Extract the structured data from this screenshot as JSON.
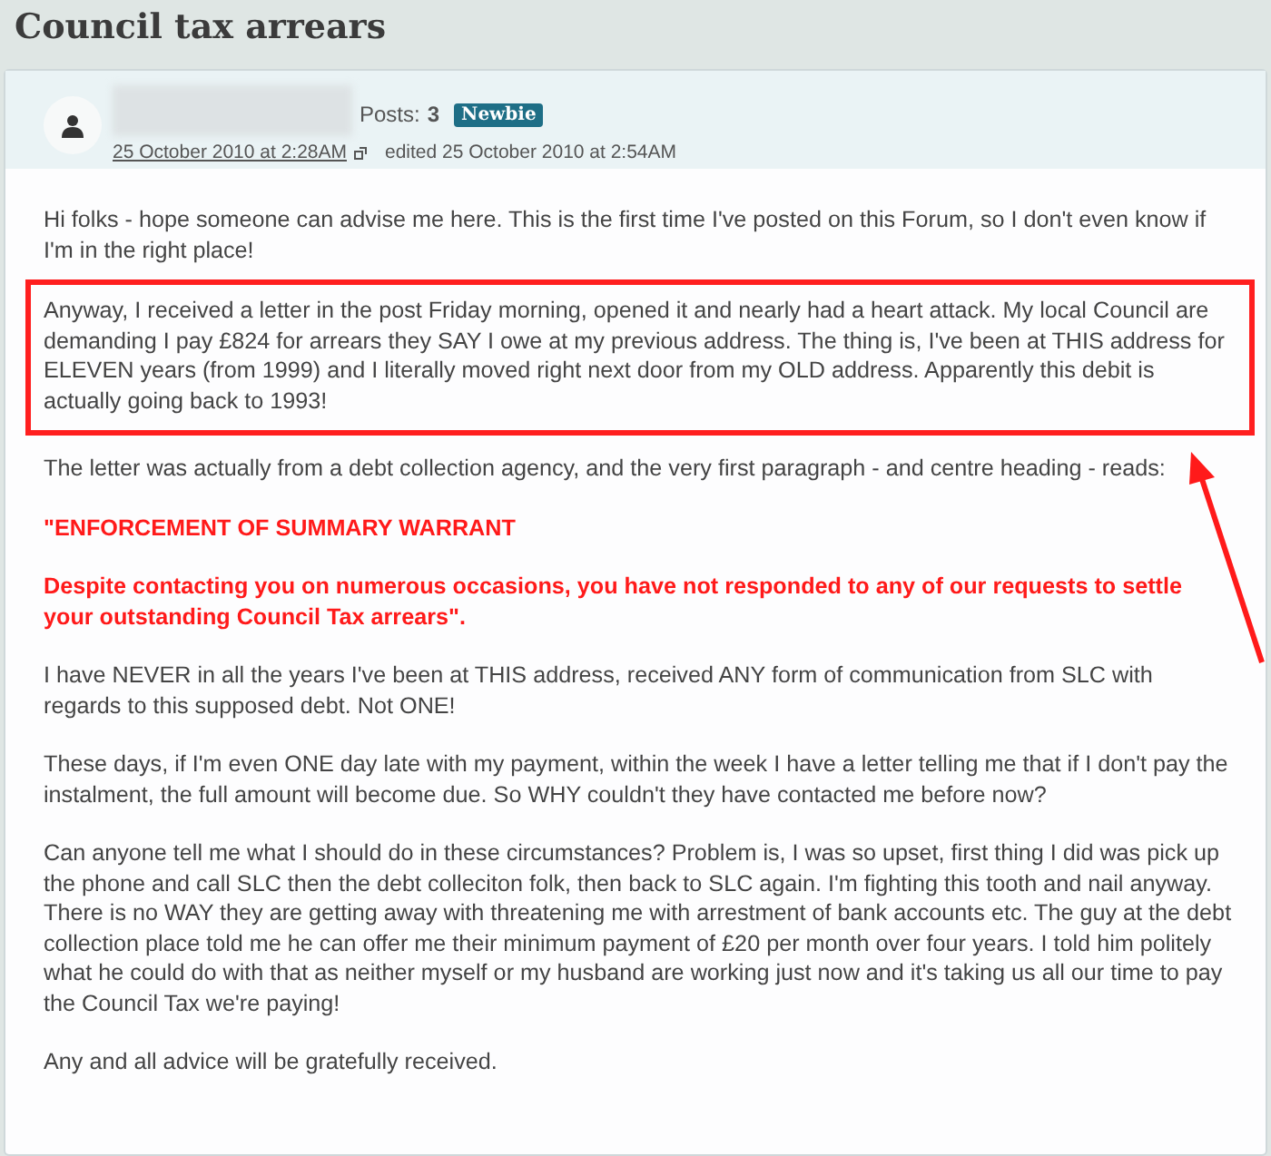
{
  "title": "Council tax arrears",
  "post": {
    "posts_label": "Posts:",
    "posts_count": "3",
    "badge": "Newbie",
    "date": "25 October 2010 at 2:28AM",
    "edited": "edited 25 October 2010 at 2:54AM",
    "paragraphs": [
      {
        "kind": "plain",
        "text": "Hi folks - hope someone can advise me here. This is the first time I've posted on this Forum, so I don't even know if I'm in the right place!"
      },
      {
        "kind": "highlighted",
        "text": "Anyway, I received a letter in the post Friday morning, opened it and nearly had a heart attack. My local Council are demanding I pay £824 for arrears they SAY I owe at my previous address. The thing is, I've been at THIS address for ELEVEN years (from 1999) and I literally moved right next door from my OLD address. Apparently this debit is actually going back to 1993!"
      },
      {
        "kind": "plain",
        "text": "The letter was actually from a debt collection agency, and the very first paragraph - and centre heading - reads:"
      },
      {
        "kind": "quote",
        "text": "\"ENFORCEMENT OF SUMMARY WARRANT"
      },
      {
        "kind": "quote",
        "text": "Despite contacting you on numerous occasions, you have not responded to any of our requests to settle your outstanding Council Tax arrears\"."
      },
      {
        "kind": "plain",
        "text": "I have NEVER in all the years I've been at THIS address, received ANY form of communication from SLC with regards to this supposed debt. Not ONE!"
      },
      {
        "kind": "plain",
        "text": "These days, if I'm even ONE day late with my payment, within the week I have a letter telling me that if I don't pay the instalment, the full amount will become due. So WHY couldn't they have contacted me before now?"
      },
      {
        "kind": "plain",
        "text": "Can anyone tell me what I should do in these circumstances? Problem is, I was so upset, first thing I did was pick up the phone and call SLC then the debt colleciton folk, then back to SLC again. I'm fighting this tooth and nail anyway. There is no WAY they are getting away with threatening me with arrestment of bank accounts etc. The guy at the debt collection place told me he can offer me their minimum payment of £20 per month over four years. I told him politely what he could do with that as neither myself or my husband are working just now and it's taking us all our time to pay the Council Tax we're paying!"
      },
      {
        "kind": "plain",
        "text": "Any and all advice will be gratefully received."
      }
    ]
  }
}
